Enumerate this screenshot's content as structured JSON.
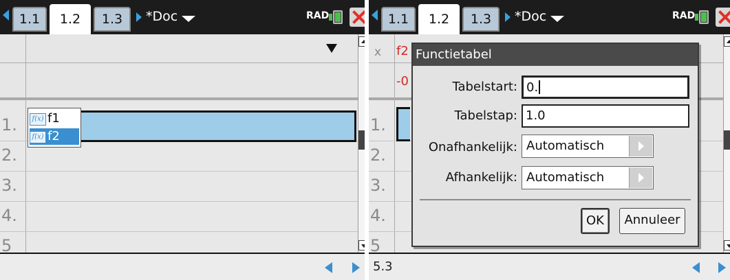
{
  "left": {
    "tabs": [
      "1.1",
      "1.2",
      "1.3"
    ],
    "active_tab": "1.2",
    "doc_title": "*Doc",
    "angle_mode": "RAD",
    "row_labels": [
      "1.",
      "2.",
      "3.",
      "4.",
      "5"
    ],
    "function_list": {
      "items": [
        {
          "icon": "f(x)",
          "label": "f1"
        },
        {
          "icon": "f(x)",
          "label": "f2"
        }
      ],
      "selected": "f2"
    },
    "entry_text": ""
  },
  "right": {
    "tabs": [
      "1.1",
      "1.2",
      "1.3"
    ],
    "active_tab": "1.2",
    "doc_title": "*Doc",
    "angle_mode": "RAD",
    "row_labels": [
      "1.",
      "2.",
      "3.",
      "4.",
      "5"
    ],
    "bg_column_x": "x",
    "bg_column_f2": "f2",
    "bg_cell_value": "-0",
    "entry_text": "5.3",
    "dialog": {
      "title": "Functietabel",
      "table_start_label": "Tabelstart:",
      "table_start_value": "0.",
      "table_step_label": "Tabelstap:",
      "table_step_value": "1.0",
      "independent_label": "Onafhankelijk:",
      "independent_value": "Automatisch",
      "dependent_label": "Afhankelijk:",
      "dependent_value": "Automatisch",
      "ok_label": "OK",
      "cancel_label": "Annuleer"
    }
  },
  "colors": {
    "accent": "#3a8fd0",
    "selection": "#9dcde9",
    "function_red": "#d12a2a",
    "topbar": "#1c1c1c"
  }
}
